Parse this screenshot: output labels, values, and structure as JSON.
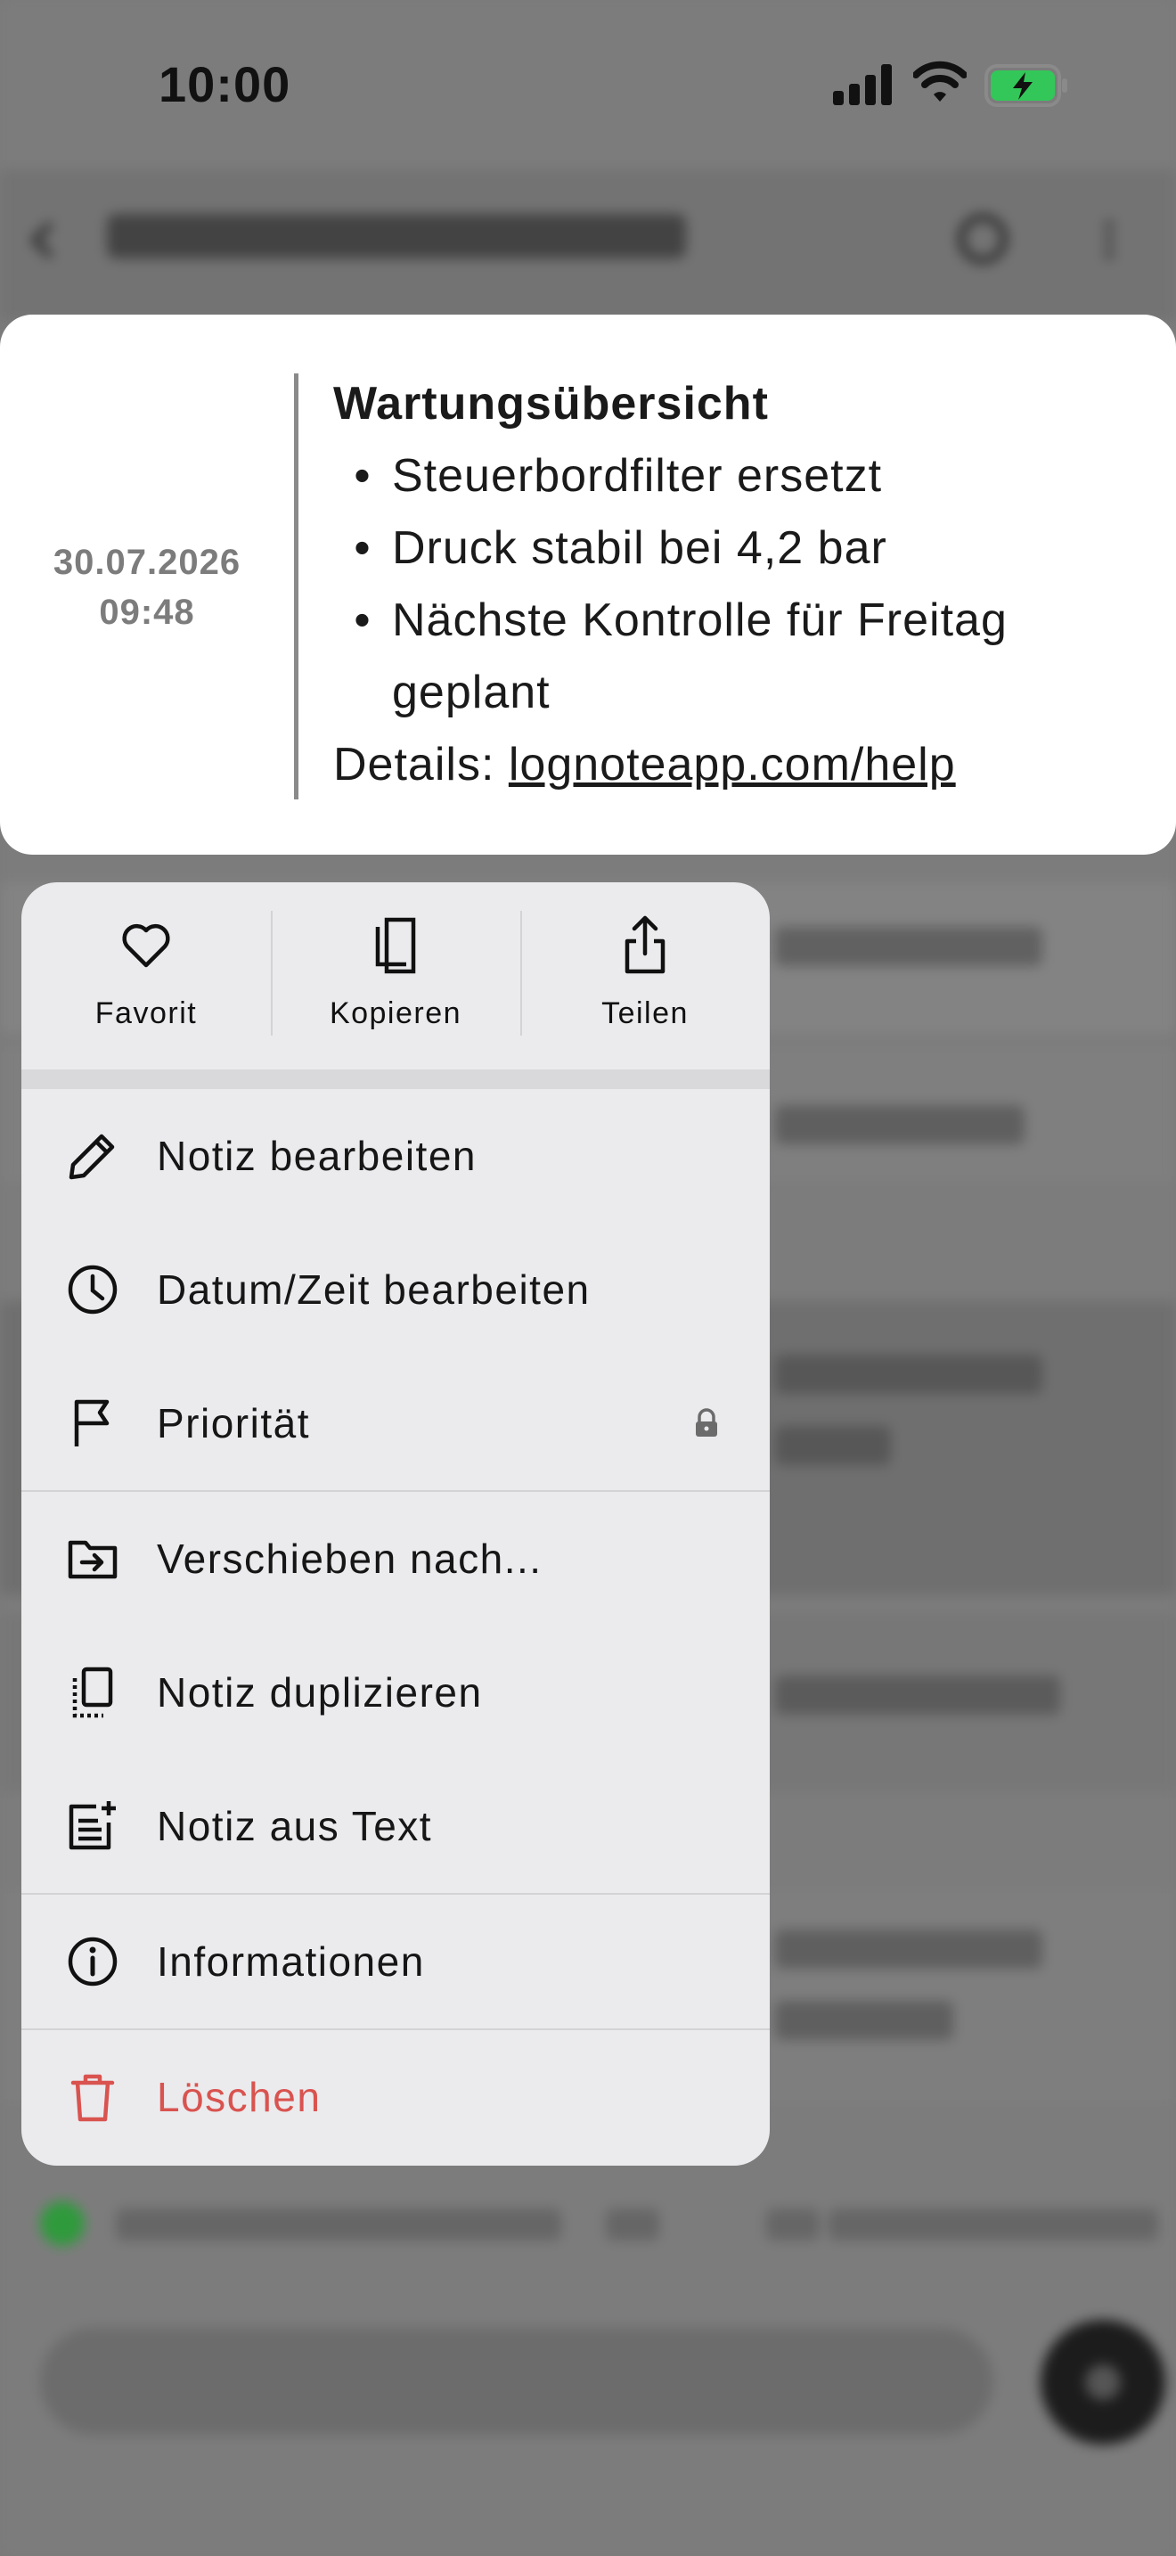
{
  "status_bar": {
    "time": "10:00",
    "icons": [
      "signal-icon",
      "wifi-icon",
      "battery-charging-icon"
    ]
  },
  "background_app": {
    "icons": [
      "back-arrow-icon",
      "search-icon",
      "more-vertical-icon",
      "add-icon"
    ]
  },
  "note": {
    "date": "30.07.2026",
    "time": "09:48",
    "heading": "Wartungsübersicht",
    "bullets": [
      "Steuerbordfilter ersetzt",
      "Druck stabil bei 4,2 bar",
      "Nächste Kontrolle für Freitag geplant"
    ],
    "details_label": "Details: ",
    "details_link": "lognoteapp.com/help"
  },
  "quick_actions": [
    {
      "label": "Favorit",
      "icon": "heart-icon"
    },
    {
      "label": "Kopieren",
      "icon": "copy-icon"
    },
    {
      "label": "Teilen",
      "icon": "share-icon"
    }
  ],
  "menu": {
    "edit_note": {
      "label": "Notiz bearbeiten",
      "icon": "pencil-icon"
    },
    "edit_datetime": {
      "label": "Datum/Zeit bearbeiten",
      "icon": "clock-icon"
    },
    "priority": {
      "label": "Priorität",
      "icon": "flag-icon",
      "locked": true
    },
    "move_to": {
      "label": "Verschieben nach...",
      "icon": "folder-move-icon"
    },
    "duplicate": {
      "label": "Notiz duplizieren",
      "icon": "duplicate-icon"
    },
    "from_text": {
      "label": "Notiz aus Text",
      "icon": "note-add-icon"
    },
    "info": {
      "label": "Informationen",
      "icon": "info-icon"
    },
    "delete": {
      "label": "Löschen",
      "icon": "trash-icon"
    }
  },
  "colors": {
    "delete": "#d9534f",
    "battery": "#33c759",
    "status_dot": "#2f9a3c"
  }
}
